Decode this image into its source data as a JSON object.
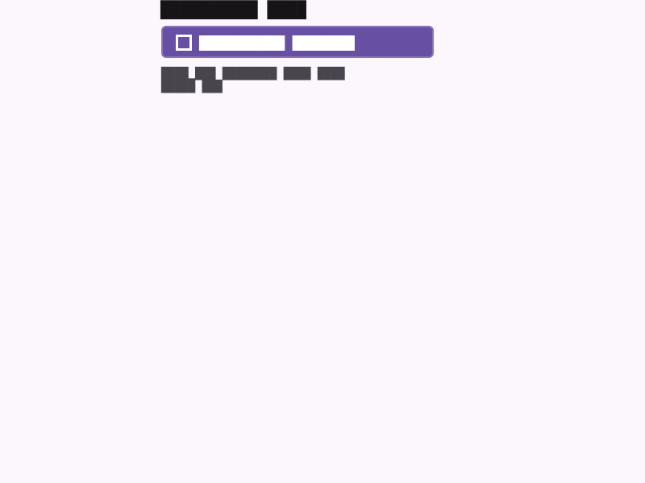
{
  "title": "██████████ ████",
  "checkbox": {
    "label": "███████████ ████████",
    "checked": false,
    "colors": {
      "container": "#6750a4",
      "border": "#8a75b7",
      "foreground": "#ffffff"
    }
  },
  "helper_text": "████▁███ ████████ ████ ████\n█████ ███",
  "colors": {
    "background": "#fcf7fd",
    "title": "#171417",
    "helper": "#48454e"
  }
}
